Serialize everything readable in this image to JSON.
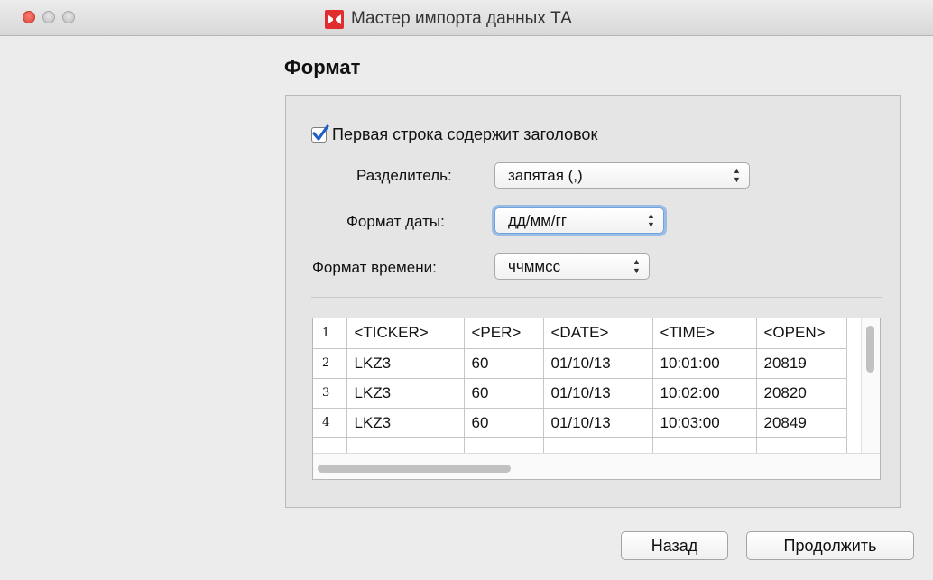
{
  "window": {
    "title": "Мастер импорта данных ТА",
    "traffic_lights": [
      "close",
      "minimize",
      "zoom"
    ]
  },
  "page": {
    "heading": "Формат"
  },
  "format": {
    "header_checkbox": {
      "label": "Первая строка содержит заголовок",
      "checked": true
    },
    "delimiter": {
      "label": "Разделитель:",
      "value": "запятая (,)"
    },
    "date_format": {
      "label": "Формат даты:",
      "value": "дд/мм/гг"
    },
    "time_format": {
      "label": "Формат времени:",
      "value": "ччммсс"
    }
  },
  "preview": {
    "rows": [
      {
        "num": "1",
        "cells": [
          "<TICKER>",
          "<PER>",
          "<DATE>",
          "<TIME>",
          "<OPEN>"
        ]
      },
      {
        "num": "2",
        "cells": [
          "LKZ3",
          "60",
          "01/10/13",
          "10:01:00",
          "20819"
        ]
      },
      {
        "num": "3",
        "cells": [
          "LKZ3",
          "60",
          "01/10/13",
          "10:02:00",
          "20820"
        ]
      },
      {
        "num": "4",
        "cells": [
          "LKZ3",
          "60",
          "01/10/13",
          "10:03:00",
          "20849"
        ]
      }
    ]
  },
  "buttons": {
    "back": "Назад",
    "continue": "Продолжить"
  },
  "colors": {
    "app_icon": "#e02d2d",
    "focus_ring": "#5f9be1",
    "window_bg": "#ececec"
  }
}
